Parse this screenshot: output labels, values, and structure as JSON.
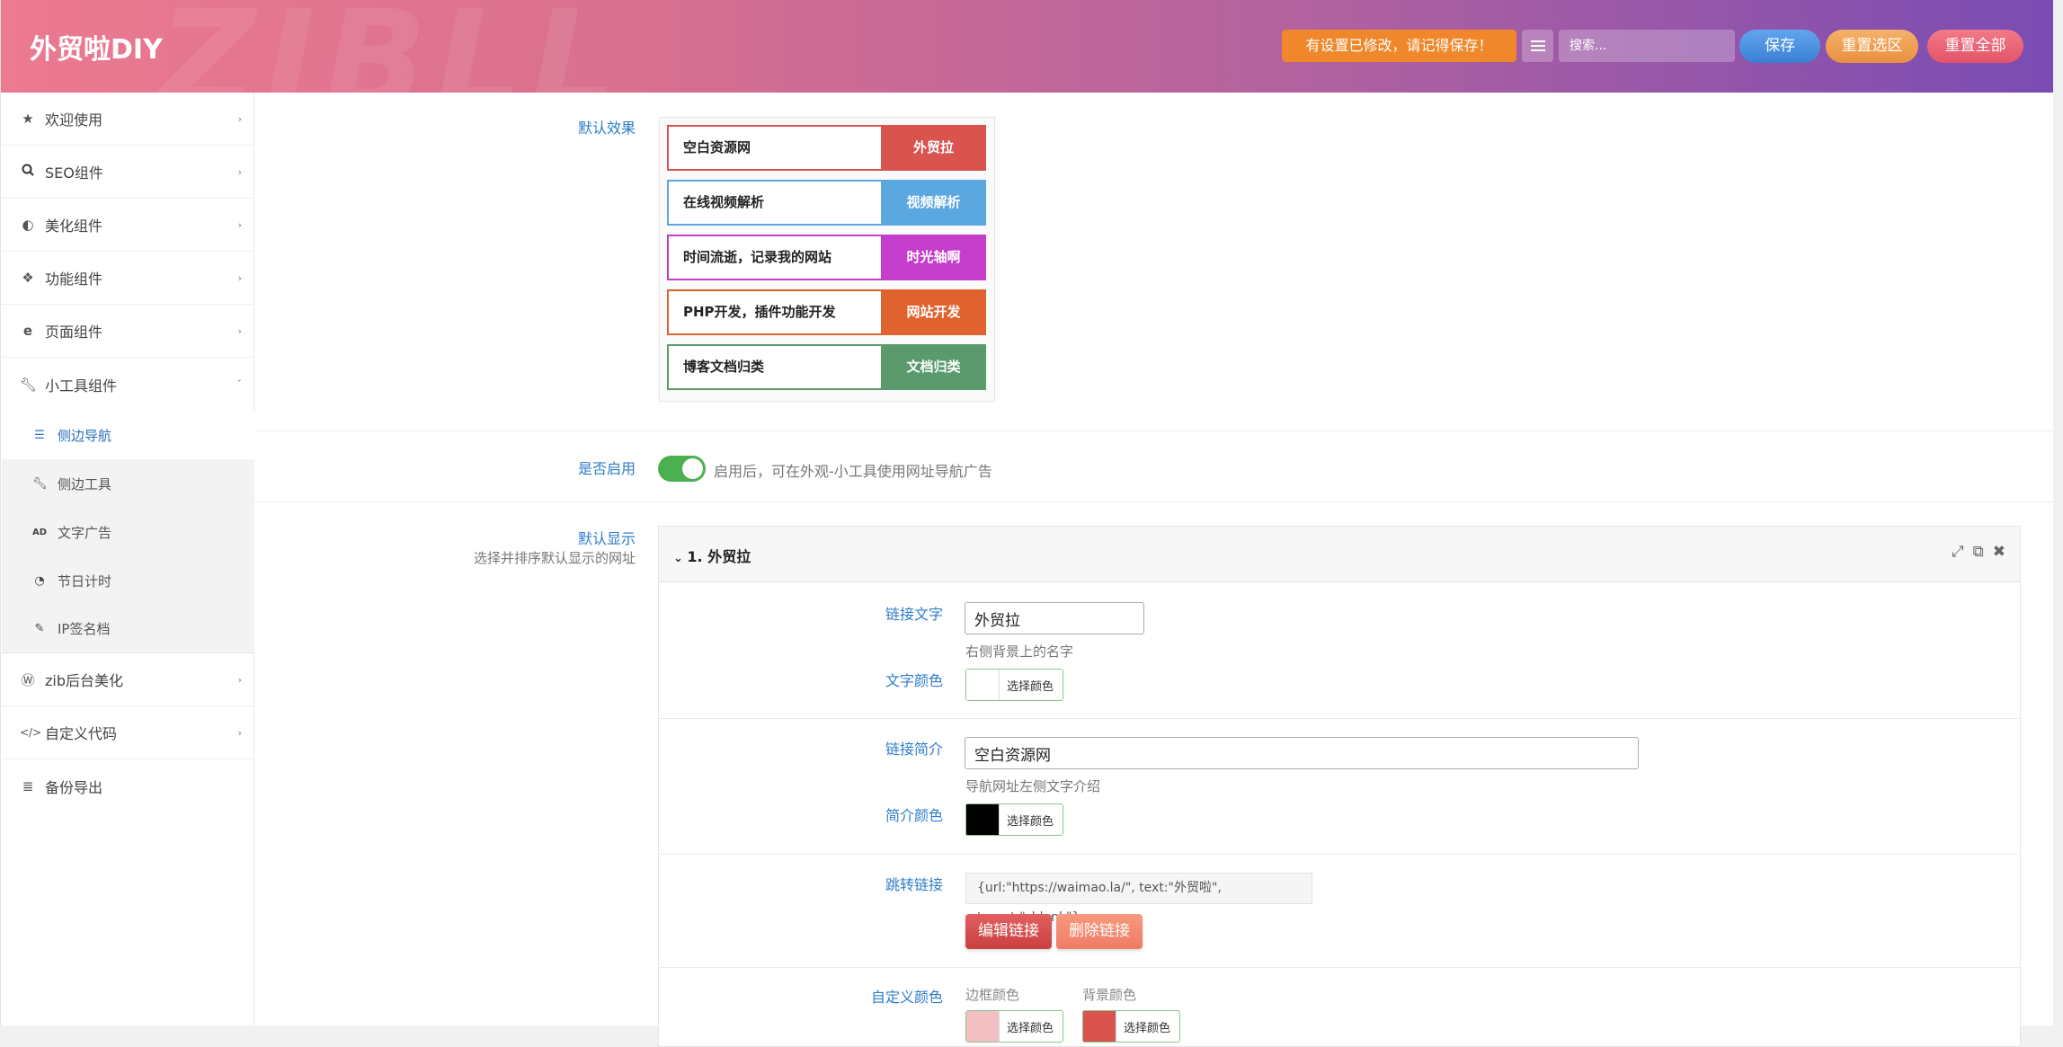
{
  "header": {
    "title": "外贸啦DIY",
    "watermark": "ZIBLL",
    "notice": "有设置已修改，请记得保存！",
    "search_placeholder": "搜索...",
    "save": "保存",
    "reset_section": "重置选区",
    "reset_all": "重置全部"
  },
  "sidebar": {
    "items": [
      {
        "label": "欢迎使用",
        "icon": "star-icon"
      },
      {
        "label": "SEO组件",
        "icon": "search-icon"
      },
      {
        "label": "美化组件",
        "icon": "contrast-icon"
      },
      {
        "label": "功能组件",
        "icon": "cubes-icon"
      },
      {
        "label": "页面组件",
        "icon": "ie-icon"
      },
      {
        "label": "小工具组件",
        "icon": "wrench-icon"
      }
    ],
    "subitems": [
      {
        "label": "侧边导航",
        "icon": "sliders-icon"
      },
      {
        "label": "侧边工具",
        "icon": "wrench-icon"
      },
      {
        "label": "文字广告",
        "icon": "ad-icon"
      },
      {
        "label": "节日计时",
        "icon": "dashboard-icon"
      },
      {
        "label": "IP签名档",
        "icon": "edit-icon"
      }
    ],
    "bottom": [
      {
        "label": "zib后台美化",
        "icon": "wordpress-icon"
      },
      {
        "label": "自定义代码",
        "icon": "code-icon"
      },
      {
        "label": "备份导出",
        "icon": "database-icon"
      }
    ]
  },
  "main": {
    "default_effect_label": "默认效果",
    "demo_rows": [
      {
        "text": "空白资源网",
        "label": "外贸拉",
        "color": "#d9534f"
      },
      {
        "text": "在线视频解析",
        "label": "视频解析",
        "color": "#5ba8e0"
      },
      {
        "text": "时间流逝，记录我的网站",
        "label": "时光轴啊",
        "color": "#c43ecb"
      },
      {
        "text": "PHP开发，插件功能开发",
        "label": "网站开发",
        "color": "#e0632f"
      },
      {
        "text": "博客文档归类",
        "label": "文档归类",
        "color": "#5a9a6d"
      }
    ],
    "enable_label": "是否启用",
    "enable_desc": "启用后，可在外观-小工具使用网址导航广告",
    "default_display_label": "默认显示",
    "default_display_desc": "选择并排序默认显示的网址",
    "group": {
      "title": "1. 外贸拉",
      "link_text_label": "链接文字",
      "link_text_value": "外贸拉",
      "link_text_help": "右侧背景上的名字",
      "text_color_label": "文字颜色",
      "pick_color": "选择颜色",
      "link_desc_label": "链接简介",
      "link_desc_value": "空白资源网",
      "link_desc_help": "导航网址左侧文字介绍",
      "desc_color_label": "简介颜色",
      "jump_label": "跳转链接",
      "jump_value": "{url:\"https://waimao.la/\", text:\"外贸啦\", target:\"_blank\"}",
      "edit_link": "编辑链接",
      "delete_link": "删除链接",
      "custom_color_label": "自定义颜色",
      "border_color": "边框颜色",
      "bg_color": "背景颜色"
    }
  },
  "colors": {
    "text_color_swatch": "#ffffff",
    "desc_color_swatch": "#000000",
    "border_color_swatch": "#f2bfc3",
    "bg_color_swatch": "#d9534f"
  }
}
